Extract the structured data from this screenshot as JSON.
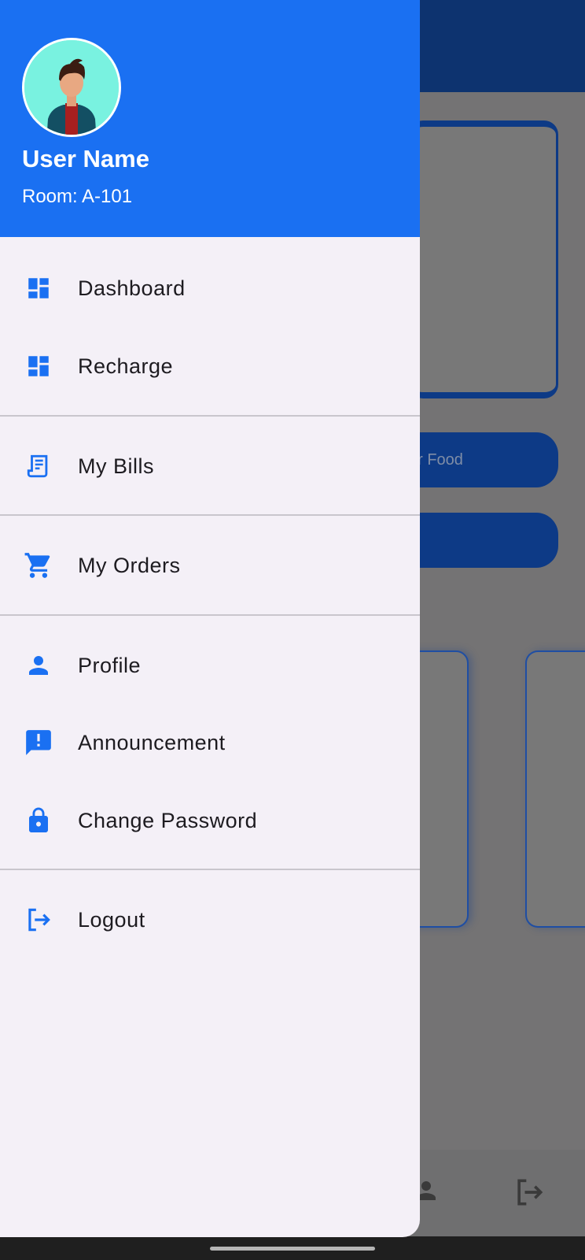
{
  "background": {
    "button_partial_label": "er Food"
  },
  "drawer": {
    "user_name": "User Name",
    "room": "Room: A-101",
    "items": [
      {
        "label": "Dashboard",
        "icon": "dashboard-icon"
      },
      {
        "label": "Recharge",
        "icon": "dashboard-icon"
      },
      {
        "label": "My Bills",
        "icon": "receipt-icon"
      },
      {
        "label": "My Orders",
        "icon": "cart-icon"
      },
      {
        "label": "Profile",
        "icon": "person-icon"
      },
      {
        "label": "Announcement",
        "icon": "announcement-icon"
      },
      {
        "label": "Change Password",
        "icon": "lock-icon"
      },
      {
        "label": "Logout",
        "icon": "logout-icon"
      }
    ]
  },
  "colors": {
    "header_blue": "#1a70f2",
    "icon_blue": "#1a70f2",
    "drawer_bg": "#f4f0f7",
    "app_bar_dimmed": "#0d336f",
    "scrim": "#747374"
  }
}
